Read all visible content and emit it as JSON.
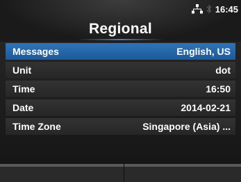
{
  "header": {
    "title": "Regional",
    "status": {
      "time": "16:45",
      "icons": [
        "network-icon",
        "bluetooth-icon"
      ]
    }
  },
  "menu": {
    "items": [
      {
        "label": "Messages",
        "value": "English, US",
        "selected": true
      },
      {
        "label": "Unit",
        "value": "dot",
        "selected": false
      },
      {
        "label": "Time",
        "value": "16:50",
        "selected": false
      },
      {
        "label": "Date",
        "value": "2014-02-21",
        "selected": false
      },
      {
        "label": "Time Zone",
        "value": "Singapore (Asia) ...",
        "selected": false
      }
    ]
  },
  "colors": {
    "selected": "#2f74b8",
    "row": "#2e2e2e",
    "accent_line": "#4a7fc4"
  }
}
